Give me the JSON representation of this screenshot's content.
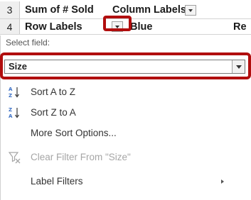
{
  "grid": {
    "rows": [
      {
        "number": "3",
        "label": "Sum of # Sold",
        "extra": "Column Labels"
      },
      {
        "number": "4",
        "label": "Row Labels",
        "extra": "Blue",
        "cut": "Re"
      }
    ]
  },
  "panel": {
    "select_field_label": "Select field:",
    "field_value": "Size",
    "menu": [
      {
        "label": "Sort A to Z",
        "icon": "sort-ascending-icon",
        "disabled": false
      },
      {
        "label": "Sort Z to A",
        "icon": "sort-descending-icon",
        "disabled": false
      },
      {
        "label": "More Sort Options...",
        "icon": "",
        "disabled": false
      },
      {
        "label": "Clear Filter From \"Size\"",
        "icon": "clear-filter-icon",
        "disabled": true
      },
      {
        "label": "Label Filters",
        "icon": "",
        "disabled": false
      }
    ]
  },
  "colors": {
    "highlight": "#b10e0e",
    "sort_icon": "#3a6fc4"
  }
}
